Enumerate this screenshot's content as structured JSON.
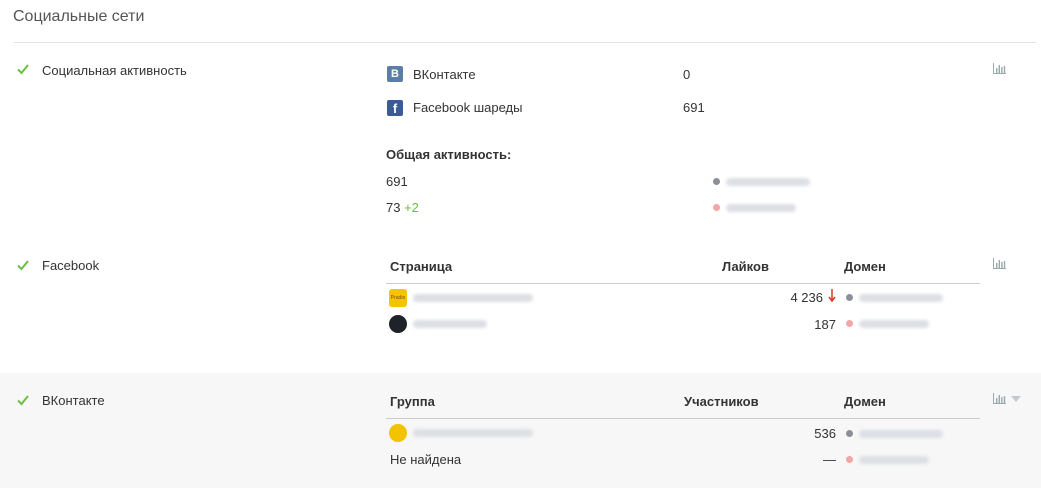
{
  "header": {
    "title": "Социальные сети"
  },
  "sections": {
    "social": {
      "label": "Социальная активность",
      "networks": [
        {
          "name": "ВКонтакте",
          "icon": "vk-icon",
          "value": "0"
        },
        {
          "name": "Facebook шареды",
          "icon": "facebook-icon",
          "value": "691"
        }
      ],
      "total_label": "Общая активность:",
      "rows": [
        {
          "value": "691",
          "delta": ""
        },
        {
          "value": "73",
          "delta": "+2"
        }
      ]
    },
    "facebook": {
      "label": "Facebook",
      "columns": [
        "Страница",
        "Лайков",
        "Домен"
      ],
      "rows": [
        {
          "avatar_text": "Pradio",
          "likes": "4 236",
          "trend": "down"
        },
        {
          "avatar_text": "",
          "likes": "187",
          "trend": ""
        }
      ]
    },
    "vkontakte": {
      "label": "ВКонтакте",
      "columns": [
        "Группа",
        "Участников",
        "Домен"
      ],
      "rows": [
        {
          "name": "",
          "members": "536"
        },
        {
          "name": "Не найдена",
          "members": "—"
        }
      ]
    }
  },
  "colors": {
    "check": "#6cbf3f",
    "vk": "#5b7ea6",
    "facebook": "#3b5a98",
    "trend_down": "#d9432e",
    "dot_primary": "#8a8f98",
    "dot_secondary": "#f2a6a6"
  },
  "icons": {
    "check": "checkmark-icon",
    "chart": "bar-chart-icon",
    "dropdown": "chevron-down-icon"
  }
}
